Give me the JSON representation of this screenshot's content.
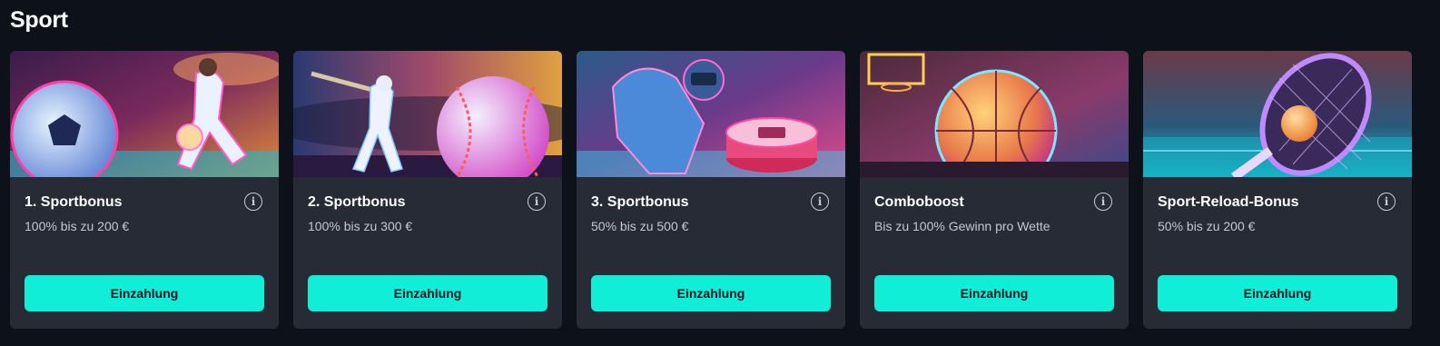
{
  "section": {
    "title": "Sport"
  },
  "cards": [
    {
      "title": "1. Sportbonus",
      "subtitle": "100% bis zu 200 €",
      "button": "Einzahlung",
      "image": "soccer-player-art"
    },
    {
      "title": "2. Sportbonus",
      "subtitle": "100% bis zu 300 €",
      "button": "Einzahlung",
      "image": "baseball-player-art"
    },
    {
      "title": "3. Sportbonus",
      "subtitle": "50% bis zu 500 €",
      "button": "Einzahlung",
      "image": "hockey-player-art"
    },
    {
      "title": "Comboboost",
      "subtitle": "Bis zu 100% Gewinn pro Wette",
      "button": "Einzahlung",
      "image": "basketball-art"
    },
    {
      "title": "Sport-Reload-Bonus",
      "subtitle": "50% bis zu 200 €",
      "button": "Einzahlung",
      "image": "tennis-racket-art"
    }
  ],
  "colors": {
    "background": "#0c111a",
    "card": "#262b35",
    "accent": "#10eed8"
  },
  "icons": {
    "info": "info-icon"
  }
}
